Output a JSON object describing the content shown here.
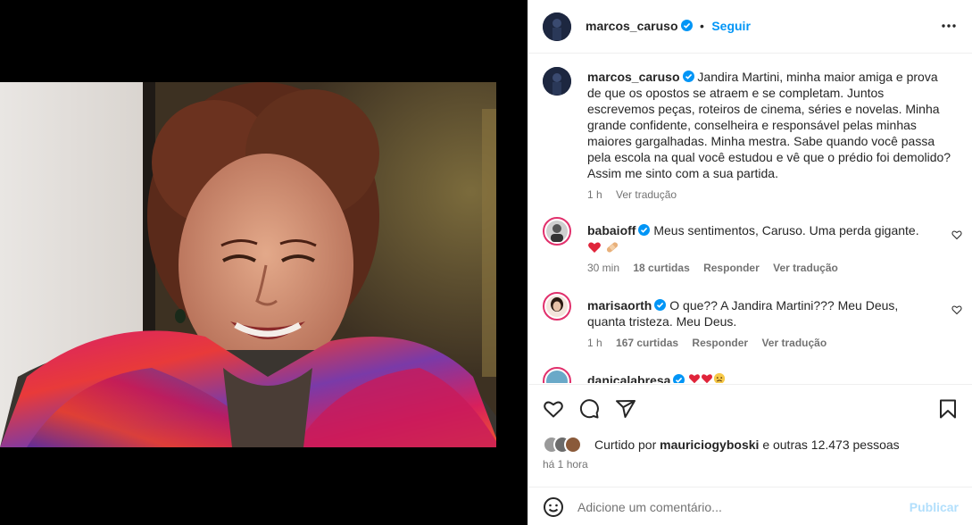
{
  "post": {
    "author": "marcos_caruso",
    "separator": "•",
    "follow_label": "Seguir",
    "caption": "Jandira Martini, minha maior amiga e prova de que os opostos se atraem e se completam. Juntos escrevemos peças, roteiros de cinema, séries e novelas. Minha grande confidente, conselheira e responsável pelas minhas maiores gargalhadas. Minha mestra. Sabe quando você passa pela escola na qual você estudou e vê que o prédio foi demolido? Assim me sinto com a sua partida.",
    "caption_time": "1 h",
    "caption_translate": "Ver tradução"
  },
  "comments": [
    {
      "user": "babaioff",
      "text": "Meus sentimentos, Caruso. Uma perda gigante.",
      "time": "30 min",
      "likes": "18 curtidas",
      "reply": "Responder",
      "translate": "Ver tradução"
    },
    {
      "user": "marisaorth",
      "text": "O que?? A Jandira Martini??? Meu Deus, quanta tristeza. Meu Deus.",
      "time": "1 h",
      "likes": "167 curtidas",
      "reply": "Responder",
      "translate": "Ver tradução"
    },
    {
      "user": "danicalabresa"
    }
  ],
  "likes": {
    "prefix": "Curtido por",
    "user": "mauriciogyboski",
    "suffix": "e outras 12.473 pessoas"
  },
  "post_time": "há 1 hora",
  "add_comment": {
    "placeholder": "Adicione um comentário...",
    "publish_label": "Publicar"
  },
  "colors": {
    "accent": "#0095f6",
    "verified": "#0095f6",
    "muted": "#737373",
    "heart_red": "#ed4956"
  },
  "icons": [
    "more-icon",
    "heart-icon",
    "comment-icon",
    "share-icon",
    "bookmark-icon",
    "emoji-icon",
    "verified-icon"
  ]
}
